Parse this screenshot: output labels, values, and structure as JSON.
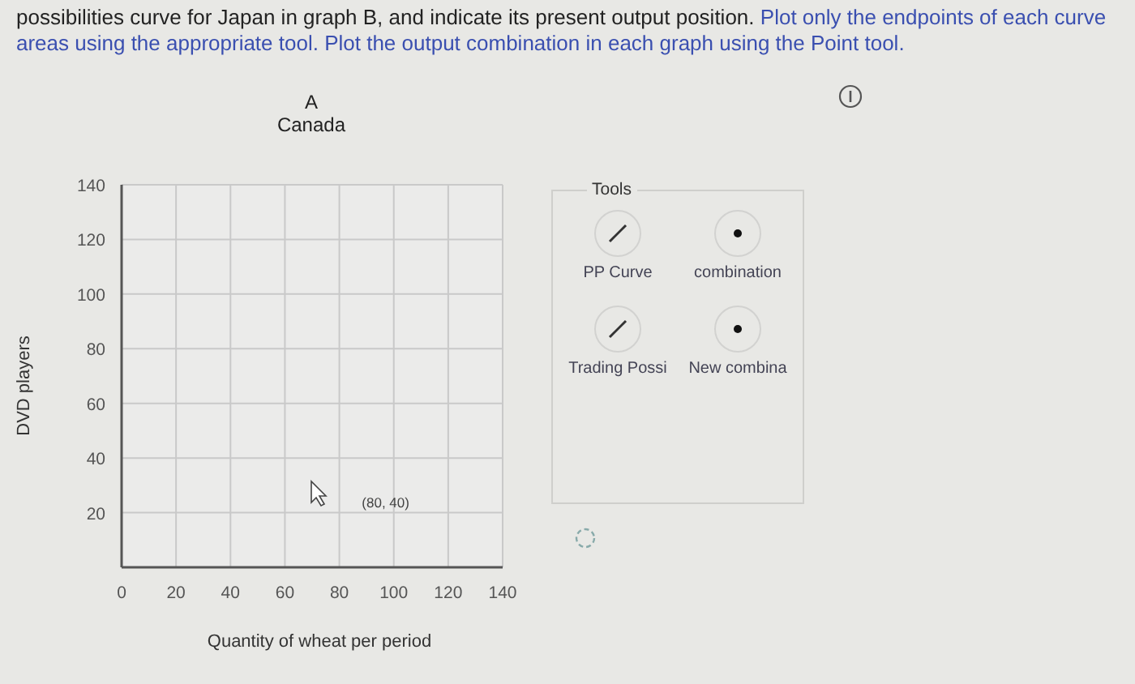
{
  "instructions": {
    "text": "possibilities curve for Japan in graph B, and indicate its present output position.",
    "hint_lines": [
      "Plot only the endpoints of each curve",
      "areas using the appropriate tool. Plot the output combination in each graph using the Point tool."
    ]
  },
  "graph": {
    "letter": "A",
    "country": "Canada",
    "chart_data": {
      "type": "scatter",
      "grid": true,
      "xlabel": "Quantity of wheat per period",
      "ylabel": "DVD players",
      "xlim": [
        0,
        140
      ],
      "ylim": [
        0,
        140
      ],
      "xticks": [
        {
          "value": 0,
          "label": "0"
        },
        20,
        40,
        60,
        80,
        100,
        120,
        140
      ],
      "yticks": [
        20,
        40,
        60,
        80,
        100,
        120,
        140
      ],
      "annotations": [
        "(80, 40)"
      ]
    }
  },
  "tools": {
    "title": "Tools",
    "items": [
      {
        "kind": "line",
        "label": "PP Curve"
      },
      {
        "kind": "point",
        "label": "combination"
      },
      {
        "kind": "line",
        "label": "Trading Possi"
      },
      {
        "kind": "point",
        "label": "New combina"
      }
    ]
  }
}
